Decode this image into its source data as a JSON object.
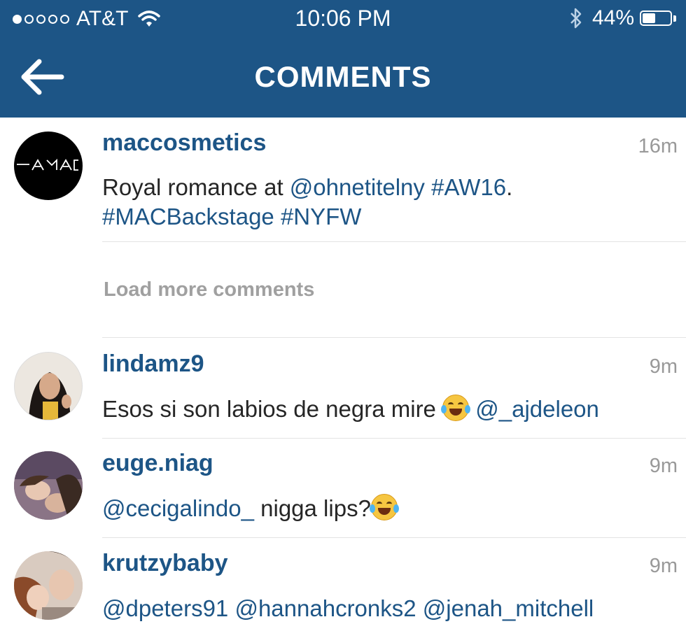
{
  "status_bar": {
    "carrier": "AT&T",
    "time": "10:06 PM",
    "battery": "44%",
    "battery_level": 0.44,
    "signal_bars_filled": 1,
    "signal_bars_total": 5
  },
  "header": {
    "title": "COMMENTS",
    "back_icon": "arrow-left-icon"
  },
  "caption": {
    "username": "maccosmetics",
    "time": "16m",
    "text_prefix": "Royal romance at ",
    "mention": "@ohnetitelny",
    "tag_aw16": "#AW16",
    "tag_aw16_suffix": ".",
    "tag_backstage": "#MACBackstage",
    "tag_nyfw": "#NYFW",
    "avatar_logo": "MAC"
  },
  "load_more": "Load more comments",
  "comments": [
    {
      "username": "lindamz9",
      "time": "9m",
      "text": "Esos si son labios de negra mire",
      "emoji": "face-with-tears-of-joy-icon",
      "mention": "@_ajdeleon"
    },
    {
      "username": "euge.niag",
      "time": "9m",
      "mention": "@cecigalindo_",
      "text": " nigga lips?",
      "emoji": "face-with-tears-of-joy-icon"
    },
    {
      "username": "krutzybaby",
      "time": "9m",
      "mentions": [
        "@dpeters91",
        "@hannahcronks2",
        "@jenah_mitchell"
      ]
    }
  ],
  "colors": {
    "header_bg": "#1d5586",
    "link": "#1d5586",
    "text": "#262626",
    "muted": "#999999"
  }
}
